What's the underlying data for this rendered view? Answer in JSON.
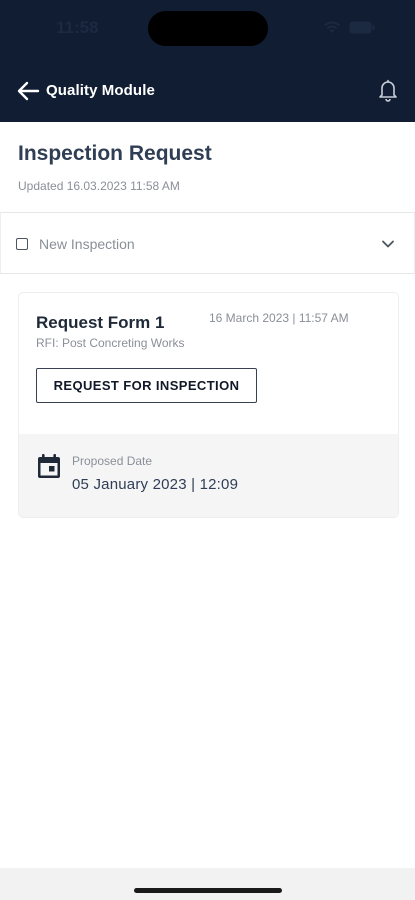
{
  "status_bar": {
    "time": "11:58",
    "icons": [
      "wifi-icon",
      "battery-icon"
    ]
  },
  "app_bar": {
    "title": "Quality Module",
    "back_icon": "arrow-left-icon",
    "notification_icon": "bell-icon"
  },
  "page": {
    "title": "Inspection Request",
    "updated": "Updated 16.03.2023 11:58 AM"
  },
  "filter": {
    "label": "New Inspection",
    "checked": false
  },
  "card": {
    "title": "Request Form 1",
    "date": "16 March 2023 | 11:57 AM",
    "subtitle": "RFI: Post Concreting Works",
    "button_label": "REQUEST FOR INSPECTION",
    "proposed_label": "Proposed Date",
    "proposed_value": "05 January 2023 | 12:09"
  },
  "colors": {
    "header_bg": "#111d33",
    "title_text": "#2f3e55",
    "muted_text": "#8a8f98",
    "footer_bg": "#f5f5f6"
  }
}
